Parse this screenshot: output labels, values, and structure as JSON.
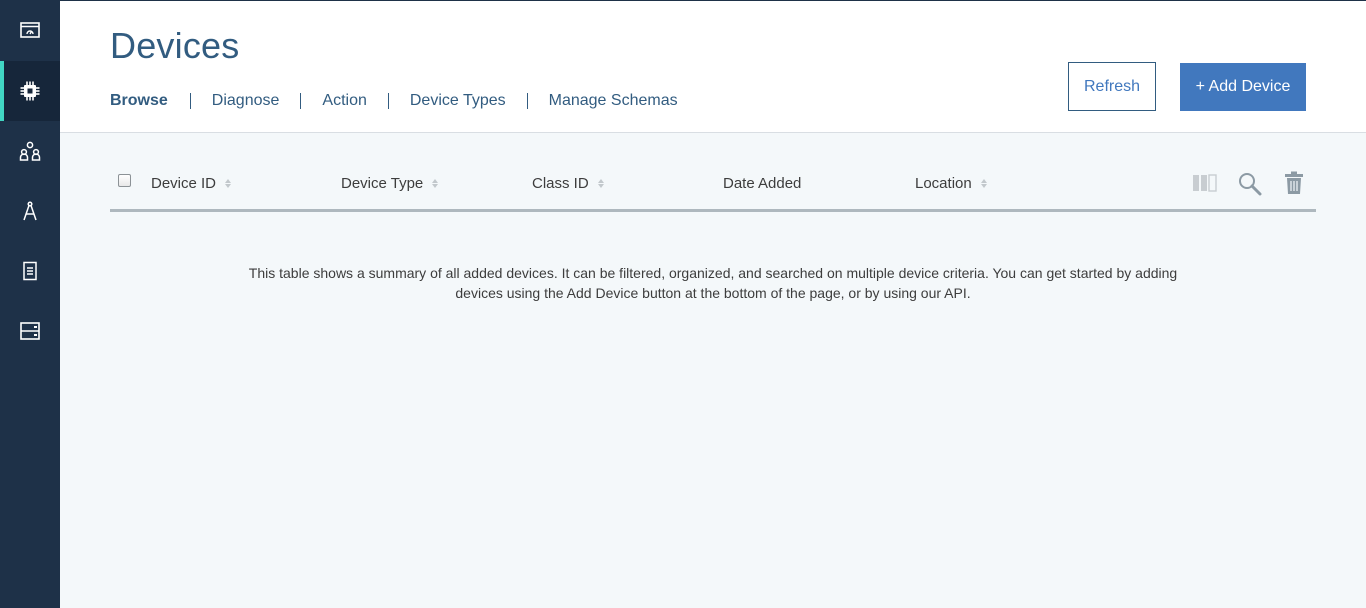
{
  "sidebar": {
    "items": [
      {
        "icon": "dashboard-icon",
        "active": false
      },
      {
        "icon": "chip-icon",
        "active": true
      },
      {
        "icon": "members-icon",
        "active": false
      },
      {
        "icon": "compass-icon",
        "active": false
      },
      {
        "icon": "document-icon",
        "active": false
      },
      {
        "icon": "server-icon",
        "active": false
      }
    ],
    "accent": "#41d6c3",
    "background": "#1e3148"
  },
  "header": {
    "title": "Devices",
    "tabs": [
      {
        "label": "Browse",
        "active": true
      },
      {
        "label": "Diagnose",
        "active": false
      },
      {
        "label": "Action",
        "active": false
      },
      {
        "label": "Device Types",
        "active": false
      },
      {
        "label": "Manage Schemas",
        "active": false
      }
    ],
    "refresh_label": "Refresh",
    "add_label": "+ Add Device"
  },
  "table": {
    "columns": [
      {
        "label": "Device ID",
        "sortable": true
      },
      {
        "label": "Device Type",
        "sortable": true
      },
      {
        "label": "Class ID",
        "sortable": true
      },
      {
        "label": "Date Added",
        "sortable": false
      },
      {
        "label": "Location",
        "sortable": true
      }
    ],
    "tools": [
      "columns-icon",
      "search-icon",
      "trash-icon"
    ],
    "empty_message": "This table shows a summary of all added devices. It can be filtered, organized, and searched on multiple device criteria. You can get started by adding devices using the Add Device button at the bottom of the page, or by using our API."
  },
  "colors": {
    "primary": "#4178be",
    "title": "#325c80",
    "content_bg": "#f4f8fa"
  }
}
